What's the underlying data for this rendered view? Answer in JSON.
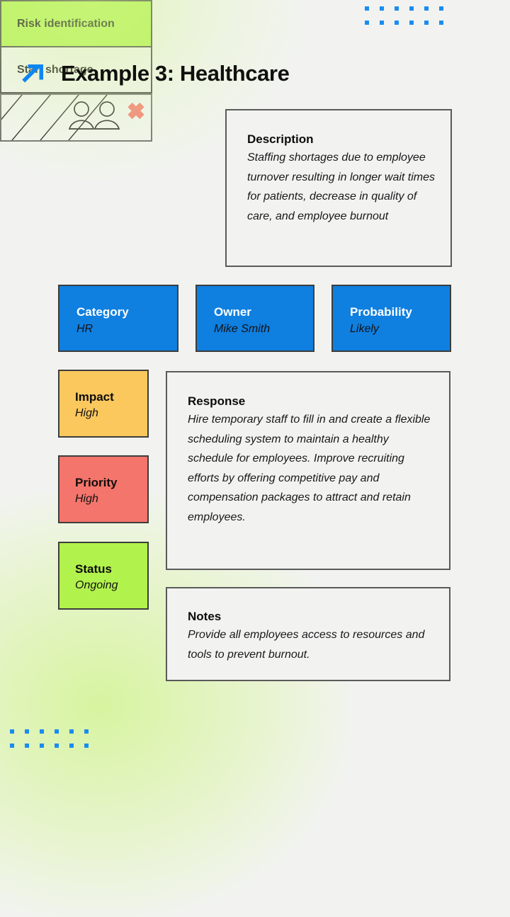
{
  "header": {
    "title": "Example 3: Healthcare",
    "icon": "arrow-up-right-icon",
    "icon_color": "#1a8cf0"
  },
  "decoration": {
    "dot_color": "#1a8cf0",
    "dot_columns": 6,
    "dot_rows": 2,
    "glow_color": "#cef484",
    "page_background": "#f2f3f1"
  },
  "risk_identification": {
    "label": "Risk identification",
    "value": "Staff shortage",
    "header_color": "#b2f24d"
  },
  "illustration": {
    "name": "staff-shortage-illustration",
    "elements": [
      "diagonal-hatch-lines",
      "person-icon",
      "person-icon",
      "red-x-icon"
    ],
    "x_color": "#f4756b"
  },
  "description": {
    "title": "Description",
    "text": "Staffing shortages due to employee turnover resulting in longer wait times for patients, decrease in quality of care, and employee burnout"
  },
  "meta": {
    "accent_color": "#0f7fe0",
    "items": [
      {
        "label": "Category",
        "value": "HR"
      },
      {
        "label": "Owner",
        "value": "Mike Smith"
      },
      {
        "label": "Probability",
        "value": "Likely"
      }
    ]
  },
  "chips": [
    {
      "label": "Impact",
      "value": "High",
      "color": "#fbc85e"
    },
    {
      "label": "Priority",
      "value": "High",
      "color": "#f4756b"
    },
    {
      "label": "Status",
      "value": "Ongoing",
      "color": "#b2f24d"
    }
  ],
  "response": {
    "title": "Response",
    "text": "Hire temporary staff to fill in and create a flexible scheduling system to maintain a healthy schedule for employees. Improve recruiting efforts by offering competitive pay and compensation packages to attract and retain employees."
  },
  "notes": {
    "title": "Notes",
    "text": "Provide all employees access to resources and tools to prevent burnout."
  }
}
